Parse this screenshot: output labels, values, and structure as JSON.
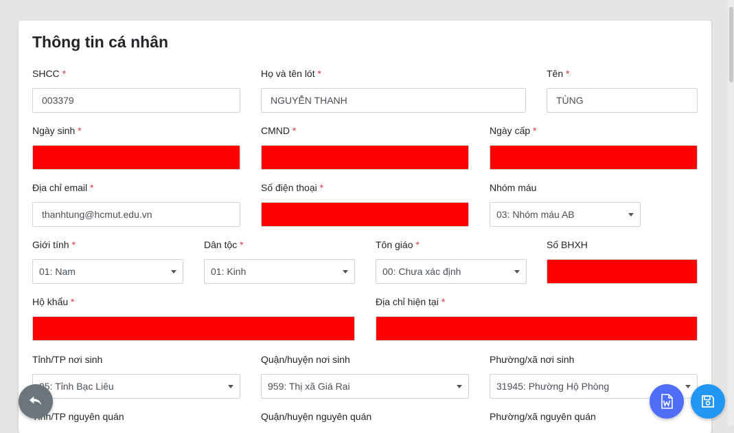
{
  "form": {
    "title": "Thông tin cá nhân",
    "required_mark": "*",
    "shcc": {
      "label": "SHCC",
      "value": "003379"
    },
    "ho_ten_lot": {
      "label": "Họ và tên lót",
      "value": "NGUYỄN THANH"
    },
    "ten": {
      "label": "Tên",
      "value": "TÙNG"
    },
    "ngay_sinh": {
      "label": "Ngày sinh"
    },
    "cmnd": {
      "label": "CMND"
    },
    "ngay_cap": {
      "label": "Ngày cấp"
    },
    "email": {
      "label": "Địa chỉ email",
      "value": "thanhtung@hcmut.edu.vn"
    },
    "so_dien_thoai": {
      "label": "Số điện thoại"
    },
    "nhom_mau": {
      "label": "Nhóm máu",
      "value": "03: Nhóm máu AB"
    },
    "gioi_tinh": {
      "label": "Giới tính",
      "value": "01: Nam"
    },
    "dan_toc": {
      "label": "Dân tộc",
      "value": "01: Kinh"
    },
    "ton_giao": {
      "label": "Tôn giáo",
      "value": "00: Chưa xác định"
    },
    "so_bhxh": {
      "label": "Số BHXH"
    },
    "ho_khau": {
      "label": "Hộ khẩu"
    },
    "dia_chi_hien_tai": {
      "label": "Địa chỉ hiện tại"
    },
    "tinh_noi_sinh": {
      "label": "Tỉnh/TP nơi sinh",
      "value": "95: Tỉnh Bạc Liêu"
    },
    "quan_noi_sinh": {
      "label": "Quận/huyện nơi sinh",
      "value": "959: Thị xã Giá Rai"
    },
    "phuong_noi_sinh": {
      "label": "Phường/xã nơi sinh",
      "value": "31945: Phường Hộ Phòng"
    },
    "tinh_nguyen_quan": {
      "label": "Tỉnh/TP nguyên quán"
    },
    "quan_nguyen_quan": {
      "label": "Quận/huyện nguyên quán"
    },
    "phuong_nguyen_quan": {
      "label": "Phường/xã nguyên quán"
    }
  },
  "colors": {
    "redacted": "#ff0000",
    "required": "#dc3545",
    "back_button": "#6c757d",
    "fab_blue": "#2196f3",
    "fab_word": "#4f6ef7"
  },
  "icons": {
    "back": "undo-arrow-icon",
    "word_export": "word-document-icon",
    "save": "floppy-disk-icon"
  }
}
